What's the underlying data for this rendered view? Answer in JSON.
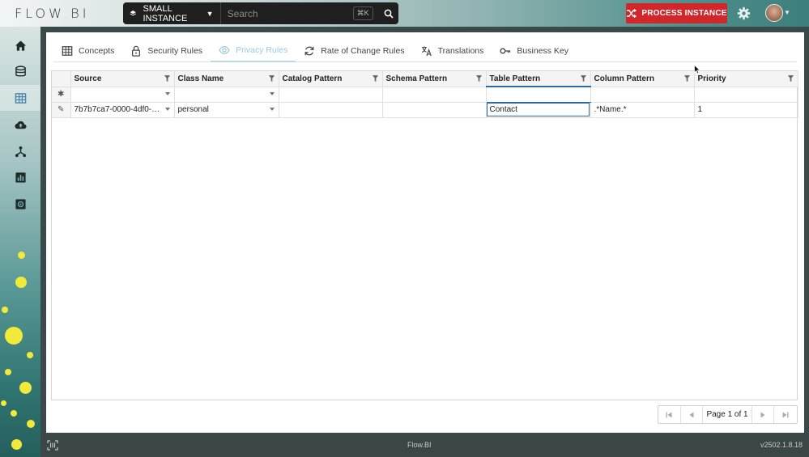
{
  "app": {
    "logo_text_a": "FLOW",
    "logo_text_b": ".",
    "logo_text_c": "BI"
  },
  "topbar": {
    "instance_label": "SMALL INSTANCE",
    "search_placeholder": "Search",
    "shortcut": "⌘K",
    "process_button_label": "PROCESS INSTANCE"
  },
  "colors": {
    "process_button": "#d3262a",
    "active_tab": "#9cc7e0",
    "selection": "#2a6aa5",
    "decor_dots": "#f2ea3a"
  },
  "sidebar": {
    "items": [
      {
        "icon": "home-icon"
      },
      {
        "icon": "database-icon"
      },
      {
        "icon": "table-icon",
        "active": true
      },
      {
        "icon": "cloud-upload-icon"
      },
      {
        "icon": "graph-icon"
      },
      {
        "icon": "chart-icon"
      },
      {
        "icon": "settings-box-icon"
      }
    ]
  },
  "tabs": [
    {
      "label": "Concepts",
      "icon": "table-icon"
    },
    {
      "label": "Security Rules",
      "icon": "lock-icon"
    },
    {
      "label": "Privacy Rules",
      "icon": "eye-icon",
      "active": true
    },
    {
      "label": "Rate of Change Rules",
      "icon": "refresh-icon"
    },
    {
      "label": "Translations",
      "icon": "translate-icon"
    },
    {
      "label": "Business Key",
      "icon": "key-icon"
    }
  ],
  "grid": {
    "columns": [
      "Source",
      "Class Name",
      "Catalog Pattern",
      "Schema Pattern",
      "Table Pattern",
      "Column Pattern",
      "Priority"
    ],
    "new_row_marker": "✱",
    "edit_row_marker": "✎",
    "rows": [
      [
        "7b7b7ca7-0000-4df0-…",
        "personal",
        "",
        "",
        "Contact",
        ".*Name.*",
        "1"
      ]
    ]
  },
  "pager": {
    "info": "Page 1 of 1"
  },
  "footer": {
    "brand": "Flow.BI",
    "version": "v2502.1.8.18"
  }
}
